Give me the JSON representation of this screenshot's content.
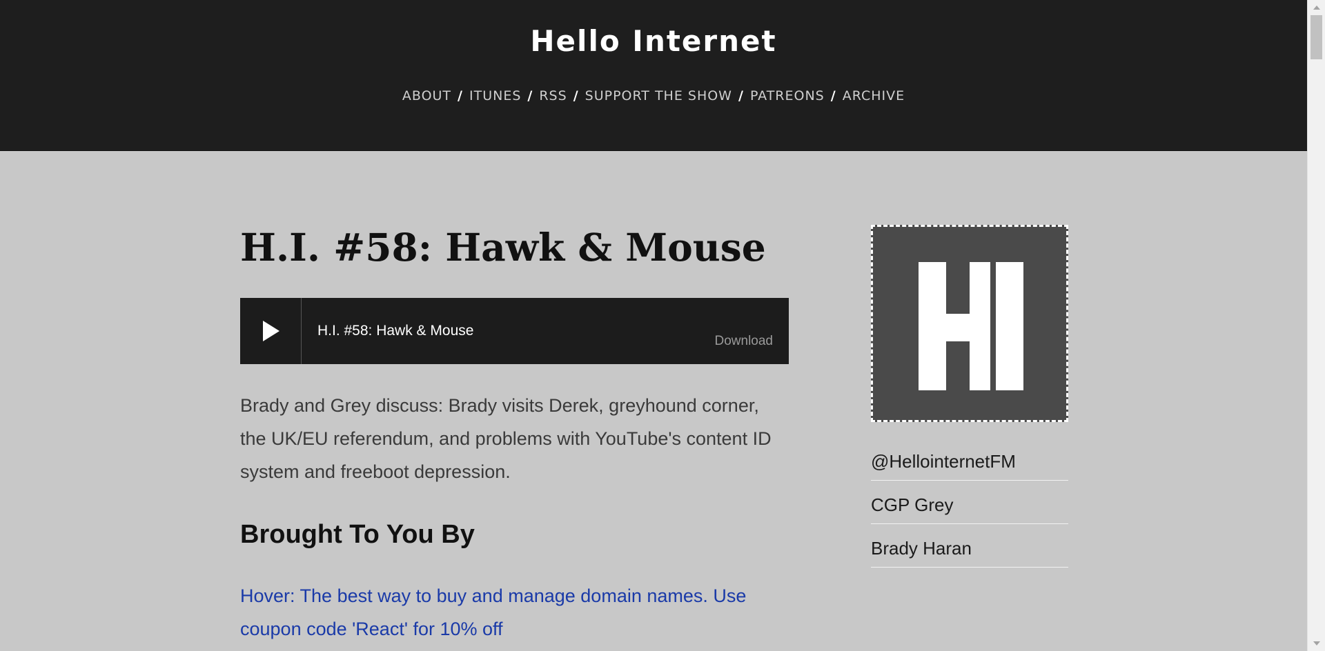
{
  "header": {
    "site_title": "Hello Internet",
    "nav": [
      {
        "label": "ABOUT"
      },
      {
        "label": "ITUNES"
      },
      {
        "label": "RSS"
      },
      {
        "label": "SUPPORT THE SHOW"
      },
      {
        "label": "PATREONS"
      },
      {
        "label": "ARCHIVE"
      }
    ],
    "separator": "/"
  },
  "post": {
    "title": "H.I. #58: Hawk & Mouse",
    "player": {
      "track_title": "H.I. #58: Hawk & Mouse",
      "download_label": "Download",
      "play_icon": "play-icon"
    },
    "description": "Brady and Grey discuss: Brady visits Derek, greyhound corner, the UK/EU referendum, and problems with YouTube's content ID system and freeboot depression.",
    "sponsors_heading": "Brought To You By",
    "sponsors": [
      {
        "text": "Hover: The best way to buy and manage domain names. Use coupon code 'React' for 10% off"
      }
    ]
  },
  "sidebar": {
    "logo": "HI",
    "links": [
      {
        "label": "@HellointernetFM"
      },
      {
        "label": "CGP Grey"
      },
      {
        "label": "Brady Haran"
      }
    ]
  },
  "colors": {
    "header_bg": "#1e1e1e",
    "page_bg": "#c8c8c8",
    "link": "#1a3aa8"
  }
}
